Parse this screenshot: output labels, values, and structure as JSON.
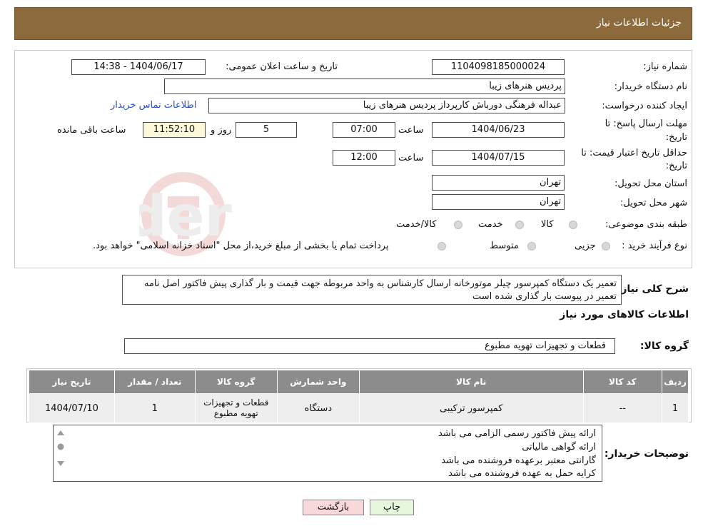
{
  "header": {
    "title": "جزئیات اطلاعات نیاز"
  },
  "fields": {
    "need_number_label": "شماره نیاز:",
    "need_number": "1104098185000024",
    "announce_label": "تاریخ و ساعت اعلان عمومی:",
    "announce_value": "1404/06/17 - 14:38",
    "buyer_org_label": "نام دستگاه خریدار:",
    "buyer_org": "پردیس هنرهای زیبا",
    "creator_label": "ایجاد کننده درخواست:",
    "creator": "عبداله فرهنگی دورباش کارپرداز پردیس هنرهای زیبا",
    "contact_link": "اطلاعات تماس خریدار",
    "deadline_label_1": "مهلت ارسال پاسخ: تا",
    "deadline_label_2": "تاریخ:",
    "deadline_date": "1404/06/23",
    "time_label": "ساعت",
    "deadline_time": "07:00",
    "days_value": "5",
    "days_label": "روز و",
    "remaining_time": "11:52:10",
    "remaining_label": "ساعت باقی مانده",
    "validity_label_1": "حداقل تاریخ اعتبار قیمت: تا",
    "validity_label_2": "تاریخ:",
    "validity_date": "1404/07/15",
    "validity_time": "12:00",
    "province_label": "استان محل تحویل:",
    "province": "تهران",
    "city_label": "شهر محل تحویل:",
    "city": "تهران",
    "category_label": "طبقه بندی موضوعی:",
    "category_options": [
      "کالا",
      "خدمت",
      "کالا/خدمت"
    ],
    "process_label": "نوع فرآیند خرید :",
    "process_options": [
      "جزیی",
      "متوسط"
    ],
    "process_note": "پرداخت تمام یا بخشی از مبلغ خرید،از محل \"اسناد خزانه اسلامی\" خواهد بود."
  },
  "description": {
    "label": "شرح کلی نیاز:",
    "text": "تعمیر  یک دستگاه  کمپرسور چیلر  موتورخانه ارسال کارشناس به واحد مربوطه جهت قیمت و بار گذاری پیش فاکتور اصل نامه تعمیر در پیوست بار گذاری شده است"
  },
  "goods_section": {
    "title": "اطلاعات کالاهای مورد نیاز",
    "group_label": "گروه کالا:",
    "group_value": "قطعات و تجهیزات تهویه مطبوع"
  },
  "table": {
    "headers": [
      "ردیف",
      "کد کالا",
      "نام کالا",
      "واحد شمارش",
      "گروه کالا",
      "تعداد / مقدار",
      "تاریخ نیاز"
    ],
    "rows": [
      [
        "1",
        "--",
        "کمپرسور ترکیبی",
        "دستگاه",
        "قطعات و تجهیزات تهویه مطبوع",
        "1",
        "1404/07/10"
      ]
    ]
  },
  "buyer_notes": {
    "label": "توضیحات خریدار:",
    "lines": [
      "ارائه پیش فاکتور رسمی الزامی می باشد",
      "ارائه گواهی مالیاتی",
      "گارانتی معتبر برعهده فروشنده می باشد",
      "کرایه حمل به عهده فروشنده می باشد"
    ]
  },
  "buttons": {
    "print": "چاپ",
    "back": "بازگشت"
  },
  "colors": {
    "header": "#8c6a3c",
    "table_header": "#8c8c8c",
    "back_button": "#f8d8d8",
    "print_button": "#e6f7dc"
  }
}
